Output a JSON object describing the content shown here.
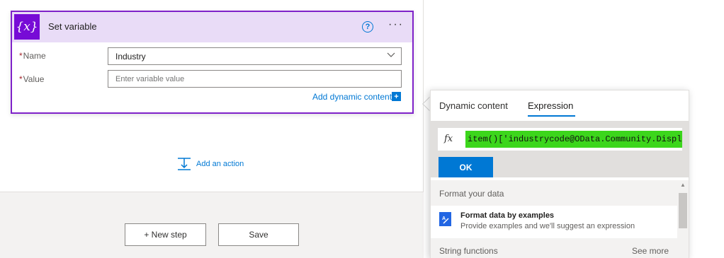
{
  "card": {
    "icon_text": "{x}",
    "title": "Set variable",
    "help_icon": "?",
    "more_icon": "···",
    "name_label": "Name",
    "required_mark": "*",
    "name_value": "Industry",
    "value_label": "Value",
    "value_placeholder": "Enter variable value",
    "add_dynamic_label": "Add dynamic content",
    "add_dynamic_icon": "+"
  },
  "canvas": {
    "add_action_label": "Add an action",
    "new_step_label": "+ New step",
    "save_label": "Save"
  },
  "flyout": {
    "tabs": [
      "Dynamic content",
      "Expression"
    ],
    "active_tab": "Expression",
    "fx_label": "fx",
    "expression": "item()['industrycode@OData.Community.Displ",
    "ok_label": "OK",
    "section_format": "Format your data",
    "format_item": {
      "title": "Format data by examples",
      "description": "Provide examples and we'll suggest an expression"
    },
    "section_string": "String functions",
    "see_more_label": "See more"
  },
  "colors": {
    "accent_purple": "#770bd6",
    "header_lavender": "#e9dcf7",
    "link_blue": "#0078d4",
    "highlight_green": "#3cd61c"
  }
}
